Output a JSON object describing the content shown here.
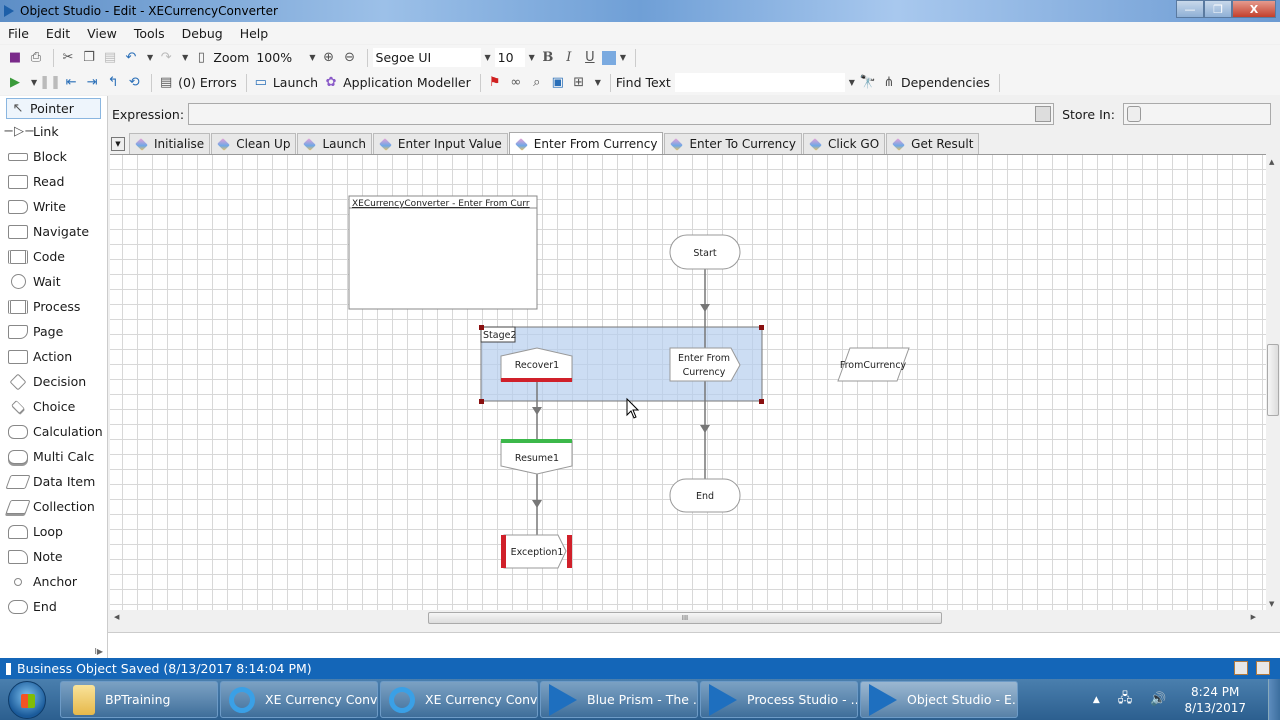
{
  "window": {
    "title": "Object Studio  - Edit - XECurrencyConverter",
    "min": "—",
    "max": "❐",
    "close": "X"
  },
  "menu": [
    "File",
    "Edit",
    "View",
    "Tools",
    "Debug",
    "Help"
  ],
  "toolbar1": {
    "zoom_label": "Zoom",
    "zoom_value": "100%",
    "font_name": "Segoe UI",
    "font_size": "10",
    "bold": "B",
    "italic": "I",
    "underline": "U",
    "fill_color": "#7aaae0"
  },
  "toolbar2": {
    "errors": "(0) Errors",
    "launch": "Launch",
    "app_modeller": "Application Modeller",
    "find_text": "Find Text",
    "find_value": "",
    "dependencies": "Dependencies"
  },
  "sidebar": {
    "items": [
      {
        "label": "Pointer",
        "icon": "pointer-icon"
      },
      {
        "label": "Link",
        "icon": "link-icon"
      },
      {
        "label": "Block",
        "icon": "block-icon"
      },
      {
        "label": "Read",
        "icon": "read-icon"
      },
      {
        "label": "Write",
        "icon": "write-icon"
      },
      {
        "label": "Navigate",
        "icon": "navigate-icon"
      },
      {
        "label": "Code",
        "icon": "code-icon"
      },
      {
        "label": "Wait",
        "icon": "wait-icon"
      },
      {
        "label": "Process",
        "icon": "process-icon"
      },
      {
        "label": "Page",
        "icon": "page-icon"
      },
      {
        "label": "Action",
        "icon": "action-icon"
      },
      {
        "label": "Decision",
        "icon": "decision-icon"
      },
      {
        "label": "Choice",
        "icon": "choice-icon"
      },
      {
        "label": "Calculation",
        "icon": "calculation-icon"
      },
      {
        "label": "Multi Calc",
        "icon": "multi-calc-icon"
      },
      {
        "label": "Data Item",
        "icon": "data-item-icon"
      },
      {
        "label": "Collection",
        "icon": "collection-icon"
      },
      {
        "label": "Loop",
        "icon": "loop-icon"
      },
      {
        "label": "Note",
        "icon": "note-icon"
      },
      {
        "label": "Anchor",
        "icon": "anchor-icon"
      },
      {
        "label": "End",
        "icon": "end-icon"
      }
    ]
  },
  "expression": {
    "label": "Expression:",
    "value": "",
    "store_label": "Store In:",
    "store_value": ""
  },
  "tabs": [
    {
      "label": "Initialise",
      "active": false
    },
    {
      "label": "Clean Up",
      "active": false
    },
    {
      "label": "Launch",
      "active": false
    },
    {
      "label": "Enter Input Value",
      "active": false
    },
    {
      "label": "Enter From Currency",
      "active": true
    },
    {
      "label": "Enter To Currency",
      "active": false
    },
    {
      "label": "Click GO",
      "active": false
    },
    {
      "label": "Get Result",
      "active": false
    }
  ],
  "diagram": {
    "info_box_title": "XECurrencyConverter - Enter From Curr",
    "block_label": "Stage2",
    "start": "Start",
    "action": [
      "Enter From",
      "Currency"
    ],
    "end": "End",
    "recover": "Recover1",
    "resume": "Resume1",
    "exception": "Exception1",
    "data_item": "FromCurrency"
  },
  "status": {
    "message": "Business Object Saved (8/13/2017 8:14:04 PM)"
  },
  "taskbar": {
    "items": [
      {
        "label": "BPTraining",
        "type": "folder"
      },
      {
        "label": "XE Currency Conv...",
        "type": "ie"
      },
      {
        "label": "XE Currency Conv...",
        "type": "ie"
      },
      {
        "label": "Blue Prism - The ...",
        "type": "bp"
      },
      {
        "label": "Process Studio  - ...",
        "type": "bp"
      },
      {
        "label": "Object Studio  - E...",
        "type": "bp",
        "active": true
      }
    ],
    "time": "8:24 PM",
    "date": "8/13/2017"
  }
}
